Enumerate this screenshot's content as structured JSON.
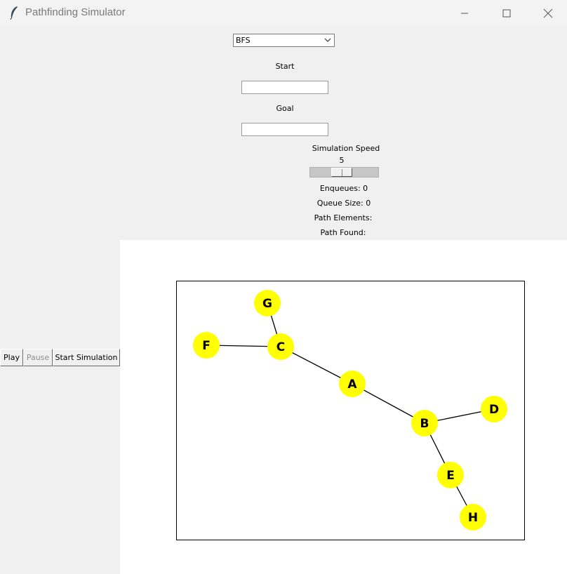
{
  "window": {
    "title": "Pathfinding Simulator",
    "icon": "feather-icon",
    "controls": [
      "minimize-icon",
      "maximize-icon",
      "close-icon"
    ]
  },
  "algorithm_select": {
    "selected": "BFS"
  },
  "start": {
    "label": "Start",
    "value": ""
  },
  "goal": {
    "label": "Goal",
    "value": ""
  },
  "speed": {
    "label": "Simulation Speed",
    "value": "5",
    "min": 1,
    "max": 10
  },
  "stats": {
    "enqueues": "Enqueues: 0",
    "queue_size": "Queue Size: 0",
    "path_elements": "Path Elements:",
    "path_found": "Path Found:"
  },
  "buttons": {
    "play": "Play",
    "pause": "Pause",
    "start_simulation": "Start Simulation"
  },
  "graph": {
    "node_color": "#ffff00",
    "edge_color": "#000000",
    "nodes": [
      "A",
      "B",
      "C",
      "D",
      "E",
      "F",
      "G",
      "H"
    ],
    "edges": [
      [
        "A",
        "C"
      ],
      [
        "A",
        "B"
      ],
      [
        "C",
        "F"
      ],
      [
        "C",
        "G"
      ],
      [
        "B",
        "D"
      ],
      [
        "B",
        "E"
      ],
      [
        "E",
        "H"
      ]
    ]
  }
}
